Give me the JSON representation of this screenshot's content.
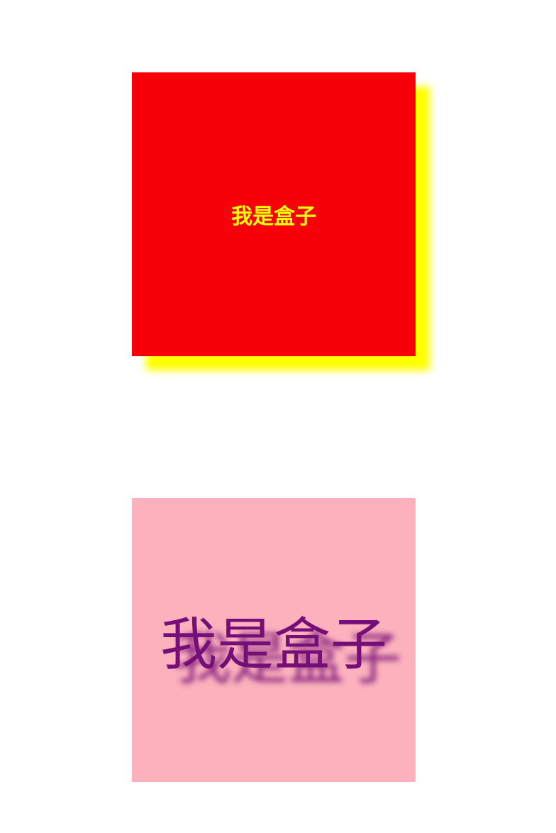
{
  "boxes": [
    {
      "text": "我是盒子",
      "background": "#f8000a",
      "text_color": "#ffff00",
      "shadow_color": "#ffff00"
    },
    {
      "text": "我是盒子",
      "background": "#fcb1bd",
      "text_color": "#760e78",
      "shadow_color": "#760e78"
    }
  ]
}
